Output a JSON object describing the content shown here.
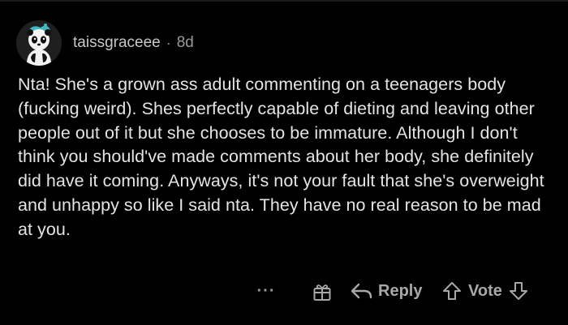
{
  "comment": {
    "username": "taissgraceee",
    "separator": "·",
    "age": "8d",
    "body": "Nta! She's a grown ass adult commenting on a teenagers body (fucking weird). Shes perfectly capable of dieting and leaving other people out of it but she chooses to be immature. Although I don't think you should've made comments about her body, she definitely did have it coming. Anyways, it's not your fault that she's overweight and unhappy so like I said nta. They have no real reason to be mad at you."
  },
  "actions": {
    "more_label": "···",
    "reply_label": "Reply",
    "vote_label": "Vote"
  },
  "icons": {
    "avatar": "panda-avatar",
    "award": "gift-icon",
    "reply": "reply-arrow-icon",
    "upvote": "upvote-arrow-icon",
    "downvote": "downvote-arrow-icon"
  },
  "colors": {
    "background": "#000000",
    "text": "#e4e4e4",
    "muted": "#a8a8a8",
    "avatar_accent": "#3fb8c4"
  }
}
